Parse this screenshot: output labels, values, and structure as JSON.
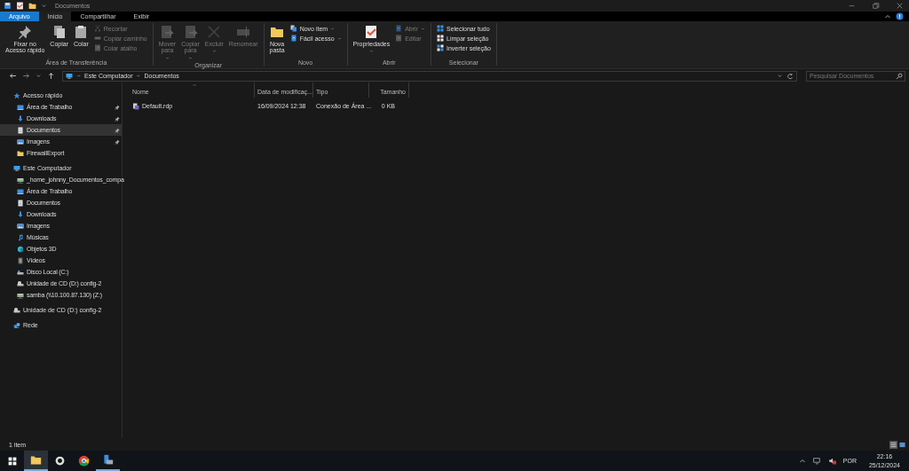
{
  "title_bar": {
    "title": "Documentos"
  },
  "ribbon_tabs": [
    {
      "label": "Arquivo",
      "kind": "file",
      "selected": false
    },
    {
      "label": "Início",
      "kind": "tab",
      "selected": true
    },
    {
      "label": "Compartilhar",
      "kind": "tab",
      "selected": false
    },
    {
      "label": "Exibir",
      "kind": "tab",
      "selected": false
    }
  ],
  "ribbon_groups": [
    {
      "label": "Área de Transferência",
      "items": [
        {
          "label": "Fixar no\nAcesso rápido",
          "kind": "large",
          "disabled": false,
          "dropdown": false
        },
        {
          "label": "Copiar",
          "kind": "large",
          "disabled": false,
          "dropdown": false
        },
        {
          "label": "Colar",
          "kind": "large",
          "disabled": false,
          "dropdown": false
        },
        {
          "label": "Recortar",
          "kind": "small",
          "disabled": true,
          "dropdown": false
        },
        {
          "label": "Copiar caminho",
          "kind": "small",
          "disabled": true,
          "dropdown": false
        },
        {
          "label": "Colar atalho",
          "kind": "small",
          "disabled": true,
          "dropdown": false
        }
      ]
    },
    {
      "label": "Organizar",
      "items": [
        {
          "label": "Mover\npara",
          "kind": "large",
          "disabled": true,
          "dropdown": true
        },
        {
          "label": "Copiar\npara",
          "kind": "large",
          "disabled": true,
          "dropdown": true
        },
        {
          "label": "Excluir",
          "kind": "large",
          "disabled": true,
          "dropdown": true
        },
        {
          "label": "Renomear",
          "kind": "large",
          "disabled": true,
          "dropdown": false
        }
      ]
    },
    {
      "label": "Novo",
      "items": [
        {
          "label": "Nova\npasta",
          "kind": "large",
          "disabled": false,
          "dropdown": false
        },
        {
          "label": "Novo item",
          "kind": "small",
          "disabled": false,
          "dropdown": true
        },
        {
          "label": "Fácil acesso",
          "kind": "small",
          "disabled": false,
          "dropdown": true
        }
      ]
    },
    {
      "label": "Abrir",
      "items": [
        {
          "label": "Propriedades",
          "kind": "large",
          "disabled": false,
          "dropdown": true
        },
        {
          "label": "Abrir",
          "kind": "small",
          "disabled": true,
          "dropdown": true
        },
        {
          "label": "Editar",
          "kind": "small",
          "disabled": true,
          "dropdown": false
        }
      ]
    },
    {
      "label": "Selecionar",
      "items": [
        {
          "label": "Selecionar tudo",
          "kind": "small",
          "disabled": false,
          "dropdown": false
        },
        {
          "label": "Limpar seleção",
          "kind": "small",
          "disabled": false,
          "dropdown": false
        },
        {
          "label": "Inverter seleção",
          "kind": "small",
          "disabled": false,
          "dropdown": false
        }
      ]
    }
  ],
  "address_bar": {
    "breadcrumbs": [
      "Este Computador",
      "Documentos"
    ],
    "search": {
      "placeholder": "Pesquisar Documentos"
    }
  },
  "sidebar": {
    "tree": [
      {
        "label": "Acesso rápido",
        "children": [
          {
            "label": "Área de Trabalho",
            "pinned": true,
            "selected": false
          },
          {
            "label": "Downloads",
            "pinned": true,
            "selected": false
          },
          {
            "label": "Documentos",
            "pinned": true,
            "selected": true
          },
          {
            "label": "Imagens",
            "pinned": true,
            "selected": false
          },
          {
            "label": "FirewallExport",
            "pinned": false,
            "selected": false
          }
        ]
      },
      {
        "label": "Este Computador",
        "children": [
          {
            "label": "_home_johnny_Documentos_compa",
            "pinned": false,
            "selected": false
          },
          {
            "label": "Área de Trabalho",
            "pinned": false,
            "selected": false
          },
          {
            "label": "Documentos",
            "pinned": false,
            "selected": false
          },
          {
            "label": "Downloads",
            "pinned": false,
            "selected": false
          },
          {
            "label": "Imagens",
            "pinned": false,
            "selected": false
          },
          {
            "label": "Músicas",
            "pinned": false,
            "selected": false
          },
          {
            "label": "Objetos 3D",
            "pinned": false,
            "selected": false
          },
          {
            "label": "Vídeos",
            "pinned": false,
            "selected": false
          },
          {
            "label": "Disco Local (C:)",
            "pinned": false,
            "selected": false
          },
          {
            "label": "Unidade de CD (D:) config-2",
            "pinned": false,
            "selected": false
          },
          {
            "label": "samba (\\\\10.100.87.130) (Z:)",
            "pinned": false,
            "selected": false
          }
        ]
      },
      {
        "label": "Unidade de CD (D:) config-2"
      },
      {
        "label": "Rede"
      }
    ]
  },
  "file_list": {
    "columns": [
      {
        "label": "Nome",
        "sorted": true
      },
      {
        "label": "Data de modificaç...",
        "sorted": false
      },
      {
        "label": "Tipo",
        "sorted": false
      },
      {
        "label": "Tamanho",
        "sorted": false
      }
    ],
    "rows": [
      {
        "cells": [
          "Default.rdp",
          "16/09/2024 12:38",
          "Conexão de Área ...",
          "0 KB"
        ]
      }
    ]
  },
  "status_bar": {
    "item_count": "1 item",
    "views": [
      {
        "selected": true
      },
      {
        "selected": false
      }
    ]
  },
  "taskbar": {
    "apps": [
      {
        "active": true,
        "running": true
      },
      {
        "active": false,
        "running": false
      },
      {
        "active": false,
        "running": false
      },
      {
        "active": false,
        "running": true
      }
    ],
    "language": "POR",
    "volume_muted": true,
    "time": "22:16",
    "date": "25/12/2024"
  }
}
